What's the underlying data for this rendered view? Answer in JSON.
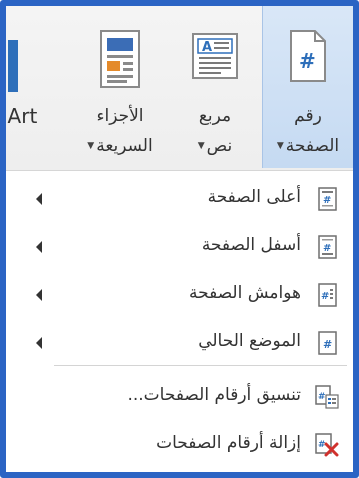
{
  "ribbon": {
    "page_number": {
      "line1": "رقم",
      "line2": "الصفحة"
    },
    "text_box": {
      "line1": "مربع",
      "line2": "نص"
    },
    "quick_parts": {
      "line1": "الأجزاء",
      "line2": "السريعة"
    },
    "wordart": {
      "label": "lArt"
    },
    "page_number_icon_glyph": "#",
    "text_box_icon_glyph": "A"
  },
  "menu": {
    "items": [
      {
        "label": "أعلى الصفحة",
        "has_submenu": true,
        "icon": "page-top-icon"
      },
      {
        "label": "أسفل الصفحة",
        "has_submenu": true,
        "icon": "page-bottom-icon"
      },
      {
        "label": "هوامش الصفحة",
        "has_submenu": true,
        "icon": "page-margins-icon"
      },
      {
        "label": "الموضع الحالي",
        "has_submenu": true,
        "icon": "current-position-icon"
      },
      {
        "label": "تنسيق أرقام الصفحات...",
        "has_submenu": false,
        "icon": "format-page-numbers-icon"
      },
      {
        "label": "إزالة أرقام الصفحات",
        "has_submenu": false,
        "icon": "remove-page-numbers-icon"
      }
    ]
  },
  "colors": {
    "frame_border": "#2b64c4",
    "active_button": "#c5daf2",
    "icon_blue": "#2e6fba",
    "remove_red": "#d0312d"
  }
}
